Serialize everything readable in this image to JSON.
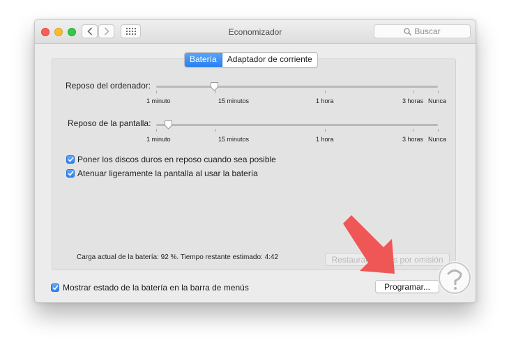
{
  "window": {
    "title": "Economizador",
    "search_placeholder": "Buscar"
  },
  "tabs": [
    {
      "label": "Batería",
      "selected": true
    },
    {
      "label": "Adaptador de corriente",
      "selected": false
    }
  ],
  "sliders": [
    {
      "label": "Reposo del ordenador:",
      "ticks": [
        "1 minuto",
        "15 minutos",
        "1 hora",
        "3 horas",
        "Nunca"
      ],
      "value": "15 minutos"
    },
    {
      "label": "Reposo de la pantalla:",
      "ticks": [
        "1 minuto",
        "15 minutos",
        "1 hora",
        "3 horas",
        "Nunca"
      ],
      "value": "1 minuto"
    }
  ],
  "checkboxes": [
    {
      "label": "Poner los discos duros en reposo cuando sea posible",
      "checked": true
    },
    {
      "label": "Atenuar ligeramente la pantalla al usar la batería",
      "checked": true
    }
  ],
  "battery_status": "Carga actual de la batería: 92 %. Tiempo restante estimado: 4:42",
  "restore_defaults_label": "Restaurar valores por omisión",
  "show_menu_status": {
    "label": "Mostrar estado de la batería en la barra de menús",
    "checked": true
  },
  "schedule_label": "Programar...",
  "colors": {
    "accent": "#2d82f1",
    "arrow": "#ef4f4f"
  },
  "icons": [
    "back-icon",
    "forward-icon",
    "grid-icon",
    "search-icon",
    "check-icon",
    "help-icon",
    "watermark-logo"
  ]
}
